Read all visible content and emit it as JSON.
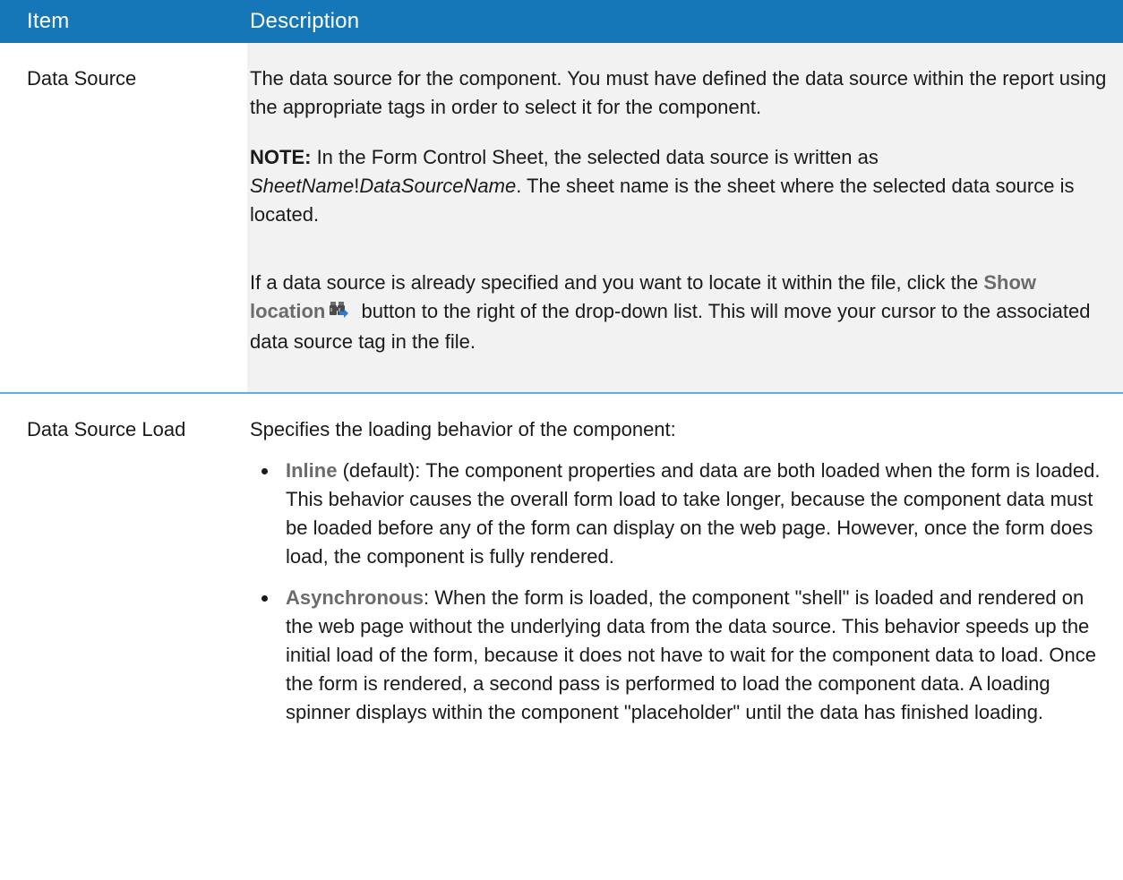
{
  "table": {
    "header": {
      "item": "Item",
      "description": "Description"
    },
    "rows": [
      {
        "item": "Data Source",
        "p1": "The data source for the component. You must have defined the data source within the report using the appropriate tags in order to select it for the component.",
        "note_label": "NOTE:",
        "note_text_1": " In the Form Control Sheet, the selected data source is written as ",
        "note_sheet": "SheetName",
        "note_bang": "!",
        "note_ds": "DataSourceName",
        "note_text_2": ". The sheet name is the sheet where the selected data source is located.",
        "p3_text_1": "If a data source is already specified and you want to locate it within the file, click the ",
        "p3_ui_term": "Show location",
        "p3_icon": "binoculars-icon",
        "p3_text_2": " button to the right of the drop-down list. This will move your cursor to the associated data source tag in the file."
      },
      {
        "item": "Data Source Load",
        "intro": "Specifies the loading behavior of the component:",
        "bullets": [
          {
            "term": "Inline",
            "text": " (default): The component properties and data are both loaded when the form is loaded. This behavior causes the overall form load to take longer, because the component data must be loaded before any of the form can display on the web page. However, once the form does load, the component is fully rendered."
          },
          {
            "term": "Asynchronous",
            "text": ": When the form is loaded, the component \"shell\" is loaded and rendered on the web page without the underlying data from the data source. This behavior speeds up the initial load of the form, because it does not have to wait for the component data to load. Once the form is rendered, a second pass is performed to load the component data. A loading spinner displays within the component \"placeholder\" until the data has finished loading."
          }
        ]
      }
    ]
  },
  "colors": {
    "header_bg": "#1577b8",
    "row_shade": "#f2f2f2",
    "row_divider": "#5ab2e3",
    "ui_term": "#6b6b6b"
  }
}
